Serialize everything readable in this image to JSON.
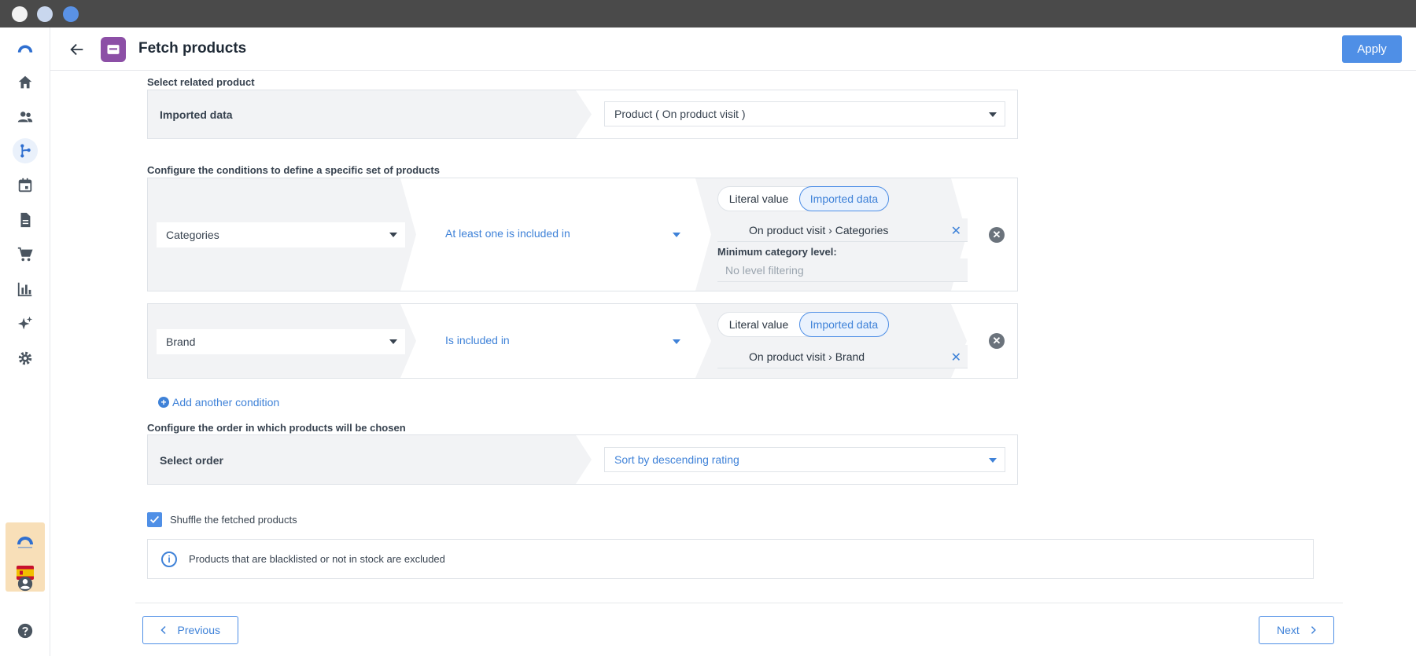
{
  "window": {
    "controls": [
      "close",
      "minimize",
      "zoom"
    ]
  },
  "sidebar": {
    "items": [
      {
        "icon": "logo-icon"
      },
      {
        "icon": "home-icon"
      },
      {
        "icon": "people-icon"
      },
      {
        "icon": "workflow-icon",
        "active": true
      },
      {
        "icon": "calendar-icon"
      },
      {
        "icon": "document-icon"
      },
      {
        "icon": "cart-icon"
      },
      {
        "icon": "bar-chart-icon"
      },
      {
        "icon": "sparkles-icon"
      },
      {
        "icon": "gear-icon"
      },
      {
        "icon": "account-icon"
      },
      {
        "icon": "help-icon"
      }
    ]
  },
  "header": {
    "title": "Fetch products",
    "apply_label": "Apply"
  },
  "related_product": {
    "section_label": "Select related product",
    "row_label": "Imported data",
    "selected": "Product ( On product visit )"
  },
  "conditions": {
    "section_label": "Configure the conditions to define a specific set of products",
    "rows": [
      {
        "field": "Categories",
        "operator": "At least one is included in",
        "toggle": {
          "literal_label": "Literal value",
          "imported_label": "Imported data",
          "selected": "Imported data"
        },
        "value": "On product visit › Categories",
        "min_level_label": "Minimum category level:",
        "min_level_placeholder": "No level filtering"
      },
      {
        "field": "Brand",
        "operator": "Is included in",
        "toggle": {
          "literal_label": "Literal value",
          "imported_label": "Imported data",
          "selected": "Imported data"
        },
        "value": "On product visit › Brand"
      }
    ],
    "add_label": "Add another condition"
  },
  "order": {
    "section_label": "Configure the order in which products will be chosen",
    "row_label": "Select order",
    "selected": "Sort by descending rating"
  },
  "shuffle": {
    "label": "Shuffle the fetched products",
    "checked": true
  },
  "info": {
    "text": "Products that are blacklisted or not in stock are excluded"
  },
  "footer": {
    "previous_label": "Previous",
    "next_label": "Next"
  },
  "colors": {
    "accent": "#4f8fe6",
    "app_icon": "#8c4fa6",
    "brand_box": "#f8dfb8"
  }
}
